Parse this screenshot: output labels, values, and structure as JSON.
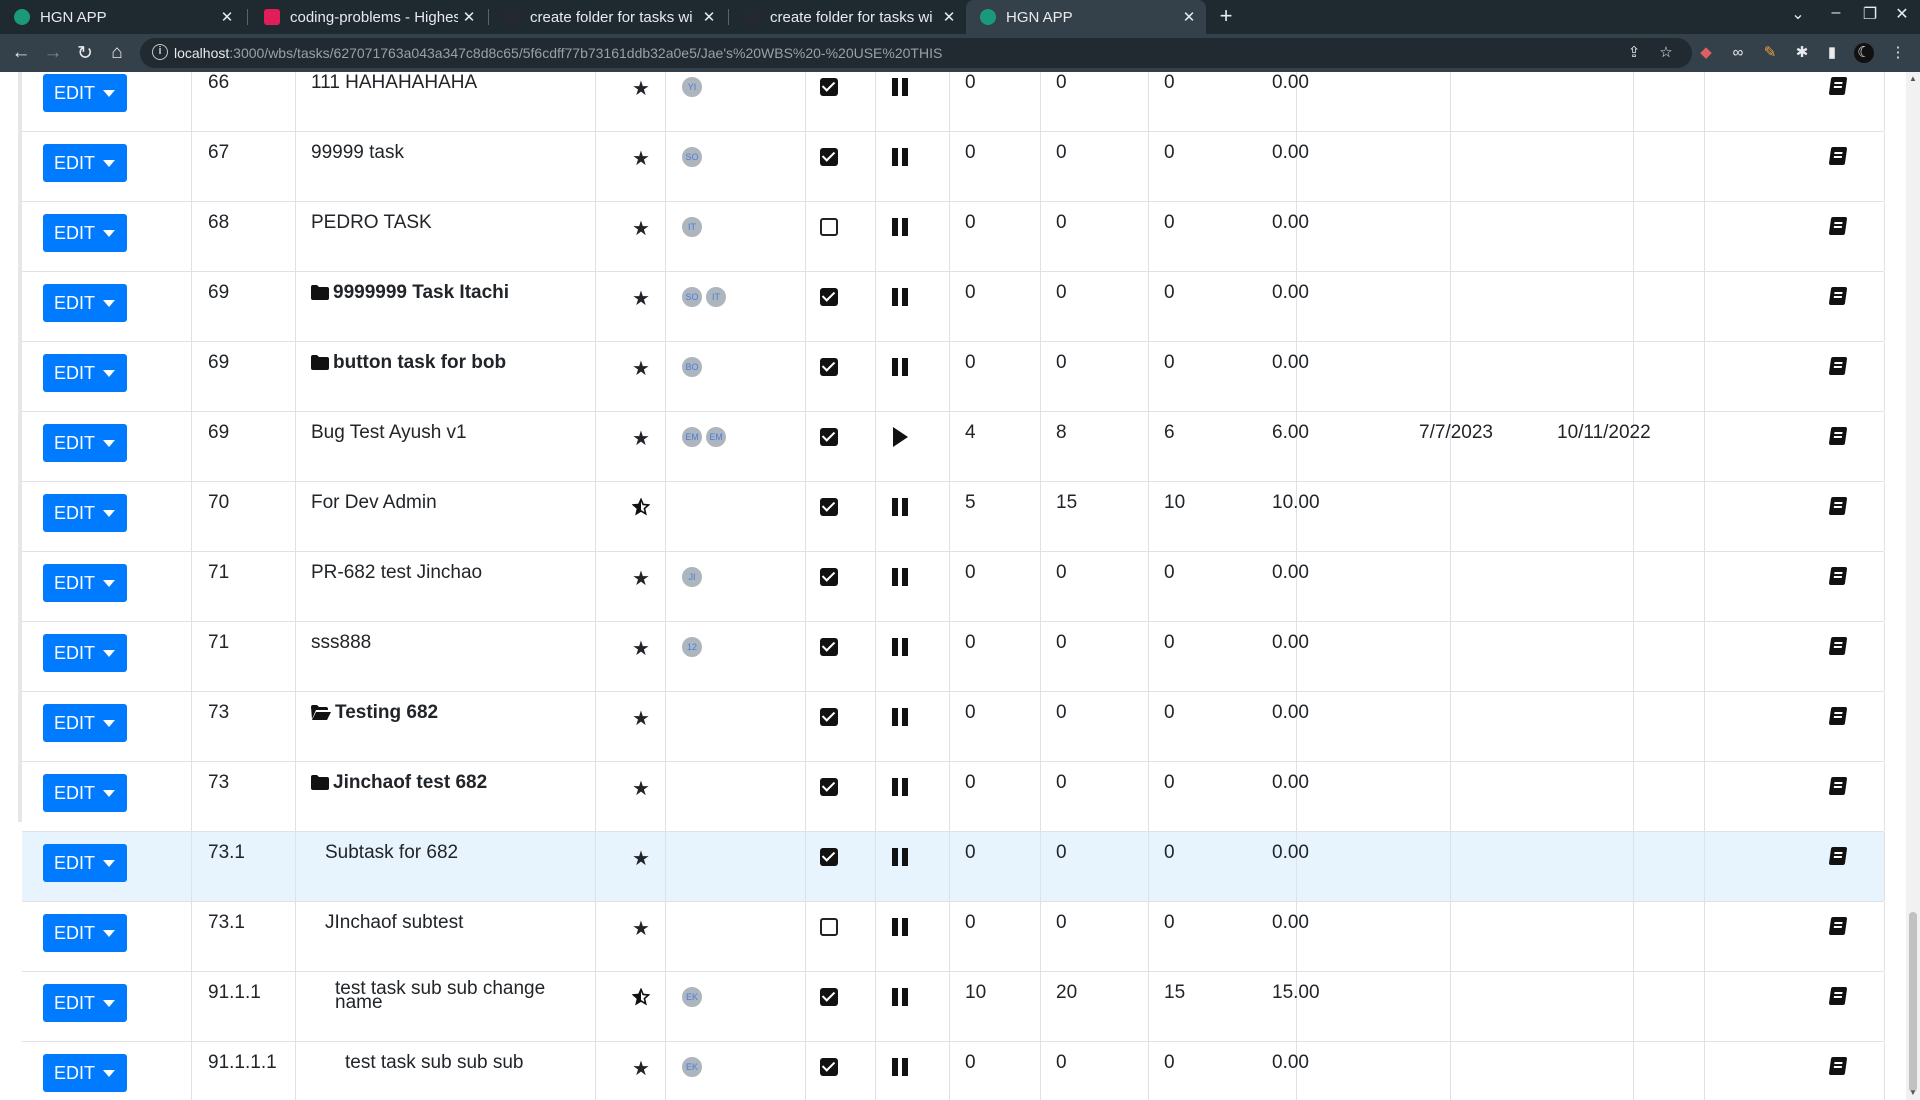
{
  "browser": {
    "tabs": [
      {
        "title": "HGN APP",
        "active": false
      },
      {
        "title": "coding-problems - Highes",
        "active": false
      },
      {
        "title": "create folder for tasks wi",
        "active": false
      },
      {
        "title": "create folder for tasks wi",
        "active": false
      },
      {
        "title": "HGN APP",
        "active": true
      }
    ],
    "url_host": "localhost",
    "url_path": ":3000/wbs/tasks/627071763a043a347c8d8c65/5f6cdff77b73161ddb32a0e5/Jae's%20WBS%20-%20USE%20THIS"
  },
  "edit_label": "EDIT",
  "rows": [
    {
      "num": "66",
      "name": "111 HAHAHAHAHA",
      "bold": false,
      "folder": "",
      "indent": 0,
      "star": "full",
      "avatars": [
        "YI"
      ],
      "checked": true,
      "state": "pause",
      "v1": "0",
      "v2": "0",
      "v3": "0",
      "v4": "0.00",
      "d1": "",
      "d2": ""
    },
    {
      "num": "67",
      "name": "99999 task",
      "bold": false,
      "folder": "",
      "indent": 0,
      "star": "full",
      "avatars": [
        "SO"
      ],
      "checked": true,
      "state": "pause",
      "v1": "0",
      "v2": "0",
      "v3": "0",
      "v4": "0.00",
      "d1": "",
      "d2": ""
    },
    {
      "num": "68",
      "name": "PEDRO TASK",
      "bold": false,
      "folder": "",
      "indent": 0,
      "star": "full",
      "avatars": [
        "IT"
      ],
      "checked": false,
      "state": "pause",
      "v1": "0",
      "v2": "0",
      "v3": "0",
      "v4": "0.00",
      "d1": "",
      "d2": ""
    },
    {
      "num": "69",
      "name": "9999999 Task Itachi",
      "bold": true,
      "folder": "closed",
      "indent": 0,
      "star": "full",
      "avatars": [
        "SO",
        "IT"
      ],
      "checked": true,
      "state": "pause",
      "v1": "0",
      "v2": "0",
      "v3": "0",
      "v4": "0.00",
      "d1": "",
      "d2": ""
    },
    {
      "num": "69",
      "name": "button task for bob",
      "bold": true,
      "folder": "closed",
      "indent": 0,
      "star": "full",
      "avatars": [
        "BO"
      ],
      "checked": true,
      "state": "pause",
      "v1": "0",
      "v2": "0",
      "v3": "0",
      "v4": "0.00",
      "d1": "",
      "d2": ""
    },
    {
      "num": "69",
      "name": "Bug Test Ayush v1",
      "bold": false,
      "folder": "",
      "indent": 0,
      "star": "full",
      "avatars": [
        "EM",
        "EM"
      ],
      "checked": true,
      "state": "play",
      "v1": "4",
      "v2": "8",
      "v3": "6",
      "v4": "6.00",
      "d1": "7/7/2023",
      "d2": "10/11/2022"
    },
    {
      "num": "70",
      "name": "For Dev Admin",
      "bold": false,
      "folder": "",
      "indent": 0,
      "star": "half",
      "avatars": [],
      "checked": true,
      "state": "pause",
      "v1": "5",
      "v2": "15",
      "v3": "10",
      "v4": "10.00",
      "d1": "",
      "d2": ""
    },
    {
      "num": "71",
      "name": "PR-682 test Jinchao",
      "bold": false,
      "folder": "",
      "indent": 0,
      "star": "full",
      "avatars": [
        "JI"
      ],
      "checked": true,
      "state": "pause",
      "v1": "0",
      "v2": "0",
      "v3": "0",
      "v4": "0.00",
      "d1": "",
      "d2": ""
    },
    {
      "num": "71",
      "name": "sss888",
      "bold": false,
      "folder": "",
      "indent": 0,
      "star": "full",
      "avatars": [
        "12"
      ],
      "checked": true,
      "state": "pause",
      "v1": "0",
      "v2": "0",
      "v3": "0",
      "v4": "0.00",
      "d1": "",
      "d2": ""
    },
    {
      "num": "73",
      "name": "Testing 682",
      "bold": true,
      "folder": "open",
      "indent": 0,
      "star": "full",
      "avatars": [],
      "checked": true,
      "state": "pause",
      "v1": "0",
      "v2": "0",
      "v3": "0",
      "v4": "0.00",
      "d1": "",
      "d2": ""
    },
    {
      "num": "73",
      "name": "Jinchaof test 682",
      "bold": true,
      "folder": "closed",
      "indent": 0,
      "star": "full",
      "avatars": [],
      "checked": true,
      "state": "pause",
      "v1": "0",
      "v2": "0",
      "v3": "0",
      "v4": "0.00",
      "d1": "",
      "d2": ""
    },
    {
      "num": "73.1",
      "name": "Subtask for 682",
      "bold": false,
      "folder": "",
      "indent": 1,
      "star": "full",
      "avatars": [],
      "checked": true,
      "state": "pause",
      "v1": "0",
      "v2": "0",
      "v3": "0",
      "v4": "0.00",
      "d1": "",
      "d2": "",
      "highlight": true
    },
    {
      "num": "73.1",
      "name": "JInchaof subtest",
      "bold": false,
      "folder": "",
      "indent": 1,
      "star": "full",
      "avatars": [],
      "checked": false,
      "state": "pause",
      "v1": "0",
      "v2": "0",
      "v3": "0",
      "v4": "0.00",
      "d1": "",
      "d2": ""
    },
    {
      "num": "91.1.1",
      "name": "test task sub sub change name",
      "bold": false,
      "folder": "",
      "indent": 2,
      "star": "half",
      "avatars": [
        "EK"
      ],
      "checked": true,
      "state": "pause",
      "v1": "10",
      "v2": "20",
      "v3": "15",
      "v4": "15.00",
      "d1": "",
      "d2": ""
    },
    {
      "num": "91.1.1.1",
      "name": "test task sub sub sub",
      "bold": false,
      "folder": "",
      "indent": 3,
      "star": "full",
      "avatars": [
        "EK"
      ],
      "checked": true,
      "state": "pause",
      "v1": "0",
      "v2": "0",
      "v3": "0",
      "v4": "0.00",
      "d1": "",
      "d2": ""
    }
  ],
  "colors": {
    "tabbar": "#1f2a30",
    "toolbar": "#35414a",
    "edit_button": "#007bff",
    "row_highlight": "#e8f4fd"
  }
}
